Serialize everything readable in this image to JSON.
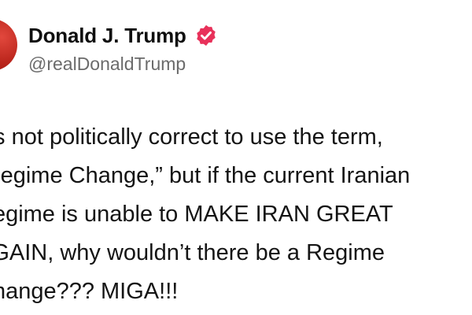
{
  "post": {
    "author": {
      "display_name": "Donald J. Trump",
      "handle": "@realDonaldTrump",
      "verified_icon": "verified-badge-icon",
      "badge_color": "#e8315a"
    },
    "text": "It’s not politically correct to use the term,\n“Regime Change,” but if the current Iranian\nRegime is unable to MAKE IRAN GREAT\nAGAIN, why wouldn’t there be a Regime\nChange??? MIGA!!!"
  }
}
